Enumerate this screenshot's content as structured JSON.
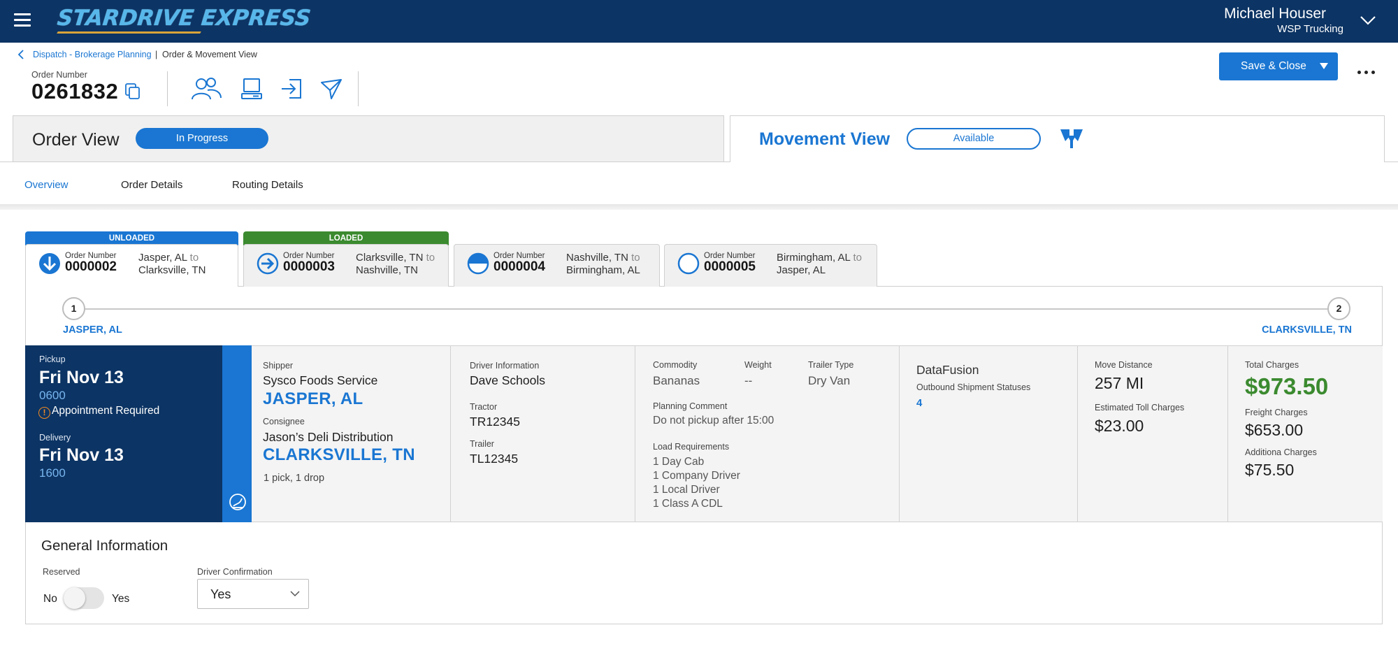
{
  "header": {
    "logo_text": "STARDRIVE EXPRESS",
    "user_name": "Michael Houser",
    "user_company": "WSP Trucking"
  },
  "breadcrumb": {
    "link": "Dispatch - Brokerage Planning",
    "separator": "|",
    "current": "Order & Movement View"
  },
  "order": {
    "label": "Order Number",
    "number": "0261832"
  },
  "toolbar": {
    "save_label": "Save & Close"
  },
  "order_view": {
    "title": "Order View",
    "status": "In Progress"
  },
  "movement_view": {
    "title": "Movement View",
    "status": "Available"
  },
  "tabs": [
    {
      "label": "Overview",
      "active": true
    },
    {
      "label": "Order Details",
      "active": false
    },
    {
      "label": "Routing Details",
      "active": false
    }
  ],
  "stops": [
    {
      "badge": "UNLOADED",
      "badge_color": "#1a76d2",
      "order_label": "Order Number",
      "order_number": "0000002",
      "from": "Jasper, AL",
      "to_word": "to",
      "to": "Clarksville, TN",
      "icon": "arrow-down-circle-icon"
    },
    {
      "badge": "LOADED",
      "badge_color": "#3b8a2f",
      "order_label": "Order Number",
      "order_number": "0000003",
      "from": "Clarksville, TN",
      "to_word": "to",
      "to": "Nashville, TN",
      "icon": "arrow-right-circle-icon"
    },
    {
      "badge": "",
      "order_label": "Order Number",
      "order_number": "0000004",
      "from": "Nashville, TN",
      "to_word": "to",
      "to": "Birmingham, AL",
      "icon": "half-circle-icon"
    },
    {
      "badge": "",
      "order_label": "Order Number",
      "order_number": "0000005",
      "from": "Birmingham, AL",
      "to_word": "to",
      "to": "Jasper, AL",
      "icon": "empty-circle-icon"
    }
  ],
  "timeline": {
    "start_num": "1",
    "start_city": "JASPER, AL",
    "end_num": "2",
    "end_city": "CLARKSVILLE, TN"
  },
  "schedule": {
    "pickup_label": "Pickup",
    "pickup_date": "Fri Nov 13",
    "pickup_time": "0600",
    "appointment": "Appointment Required",
    "delivery_label": "Delivery",
    "delivery_date": "Fri Nov 13",
    "delivery_time": "1600"
  },
  "parties": {
    "shipper_label": "Shipper",
    "shipper_name": "Sysco Foods Service",
    "shipper_city": "JASPER, AL",
    "consignee_label": "Consignee",
    "consignee_name": "Jason’s Deli Distribution",
    "consignee_city": "CLARKSVILLE, TN",
    "stops_summary": "1 pick, 1 drop"
  },
  "driver": {
    "driver_label": "Driver Information",
    "driver_name": "Dave Schools",
    "tractor_label": "Tractor",
    "tractor": "TR12345",
    "trailer_label": "Trailer",
    "trailer": "TL12345"
  },
  "load": {
    "commodity_label": "Commodity",
    "commodity": "Bananas",
    "weight_label": "Weight",
    "weight": "--",
    "trailer_type_label": "Trailer Type",
    "trailer_type": "Dry Van",
    "planning_label": "Planning Comment",
    "planning_comment": "Do not pickup after 15:00",
    "requirements_label": "Load Requirements",
    "requirements": [
      "1 Day Cab",
      "1 Company Driver",
      "1 Local Driver",
      "1 Class A CDL"
    ]
  },
  "datafusion": {
    "title": "DataFusion",
    "label": "Outbound Shipment Statuses",
    "count": "4"
  },
  "distance": {
    "move_label": "Move Distance",
    "move_value": "257 MI",
    "toll_label": "Estimated Toll Charges",
    "toll_value": "$23.00"
  },
  "charges": {
    "total_label": "Total Charges",
    "total_value": "$973.50",
    "freight_label": "Freight Charges",
    "freight_value": "$653.00",
    "additional_label": "Additiona Charges",
    "additional_value": "$75.50"
  },
  "general_info": {
    "title": "General Information",
    "reserved_label": "Reserved",
    "toggle_no": "No",
    "toggle_yes": "Yes",
    "reserved_value": false,
    "driver_conf_label": "Driver Confirmation",
    "driver_conf_value": "Yes"
  },
  "colors": {
    "navy": "#0c3464",
    "accent_blue": "#1a76d2",
    "green": "#3b8a2f",
    "warning": "#f28a22"
  }
}
